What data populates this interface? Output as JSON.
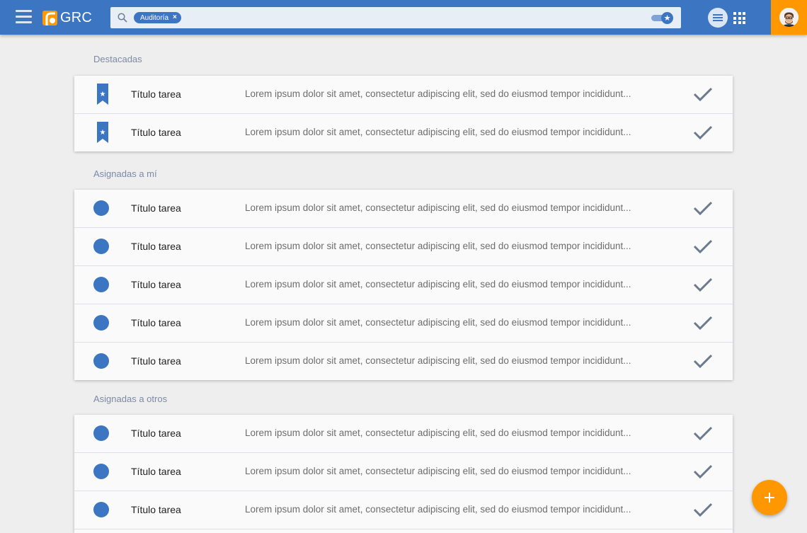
{
  "app": {
    "logo_text": "GRC"
  },
  "search": {
    "chip_label": "Auditoría",
    "chip_remove": "×",
    "placeholder": ""
  },
  "sections": [
    {
      "title": "Destacadas",
      "marker": "bookmark-star-icon",
      "items": [
        {
          "title": "Título tarea",
          "desc": "Lorem ipsum dolor sit amet, consectetur adipiscing elit, sed do eiusmod tempor incididunt..."
        },
        {
          "title": "Título tarea",
          "desc": "Lorem ipsum dolor sit amet, consectetur adipiscing elit, sed do eiusmod tempor incididunt..."
        }
      ]
    },
    {
      "title": "Asignadas a mí",
      "marker": "circle",
      "items": [
        {
          "title": "Título tarea",
          "desc": "Lorem ipsum dolor sit amet, consectetur adipiscing elit, sed do eiusmod tempor incididunt..."
        },
        {
          "title": "Título tarea",
          "desc": "Lorem ipsum dolor sit amet, consectetur adipiscing elit, sed do eiusmod tempor incididunt..."
        },
        {
          "title": "Título tarea",
          "desc": "Lorem ipsum dolor sit amet, consectetur adipiscing elit, sed do eiusmod tempor incididunt..."
        },
        {
          "title": "Título tarea",
          "desc": "Lorem ipsum dolor sit amet, consectetur adipiscing elit, sed do eiusmod tempor incididunt..."
        },
        {
          "title": "Título tarea",
          "desc": "Lorem ipsum dolor sit amet, consectetur adipiscing elit, sed do eiusmod tempor incididunt..."
        }
      ]
    },
    {
      "title": "Asignadas a otros",
      "marker": "circle",
      "items": [
        {
          "title": "Título tarea",
          "desc": "Lorem ipsum dolor sit amet, consectetur adipiscing elit, sed do eiusmod tempor incididunt..."
        },
        {
          "title": "Título tarea",
          "desc": "Lorem ipsum dolor sit amet, consectetur adipiscing elit, sed do eiusmod tempor incididunt..."
        },
        {
          "title": "Título tarea",
          "desc": "Lorem ipsum dolor sit amet, consectetur adipiscing elit, sed do eiusmod tempor incididunt..."
        }
      ]
    }
  ],
  "fab": {
    "icon": "plus-icon"
  },
  "colors": {
    "primary": "#3c75c2",
    "accent": "#ff9800",
    "background": "#eeeeee",
    "check": "#6b7a8c"
  }
}
